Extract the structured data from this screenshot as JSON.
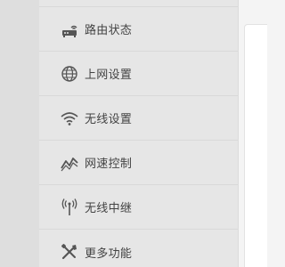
{
  "sidebar": {
    "items": [
      {
        "label": "路由状态",
        "icon": "router-icon"
      },
      {
        "label": "上网设置",
        "icon": "globe-icon"
      },
      {
        "label": "无线设置",
        "icon": "wifi-icon"
      },
      {
        "label": "网速控制",
        "icon": "speed-chart-icon"
      },
      {
        "label": "无线中继",
        "icon": "antenna-icon"
      },
      {
        "label": "更多功能",
        "icon": "tools-icon"
      }
    ]
  },
  "colors": {
    "sidebar_bg": "#e6e6e6",
    "text": "#444444",
    "icon": "#555555",
    "content_bg": "#ffffff"
  }
}
